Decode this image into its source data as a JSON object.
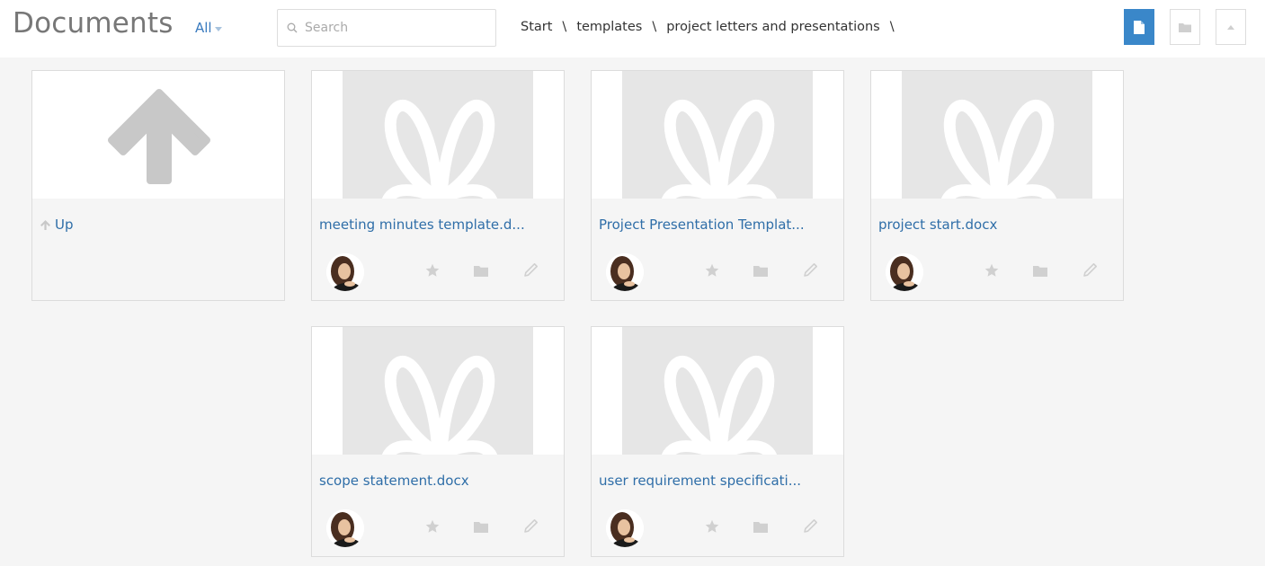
{
  "header": {
    "title": "Documents",
    "filter_label": "All",
    "search_placeholder": "Search",
    "breadcrumb": [
      "Start",
      "templates",
      "project letters and presentations"
    ],
    "breadcrumb_separator": "\\"
  },
  "toolbar": {
    "view_documents_icon": "document-icon",
    "view_folders_icon": "folder-icon",
    "collapse_icon": "chevron-up-icon",
    "accent_color": "#3a87c9"
  },
  "up_card": {
    "label": "Up"
  },
  "documents": [
    {
      "name": "meeting minutes template.d..."
    },
    {
      "name": "Project Presentation Templat..."
    },
    {
      "name": "project start.docx"
    },
    {
      "name": "scope statement.docx"
    },
    {
      "name": "user requirement specificati..."
    }
  ]
}
